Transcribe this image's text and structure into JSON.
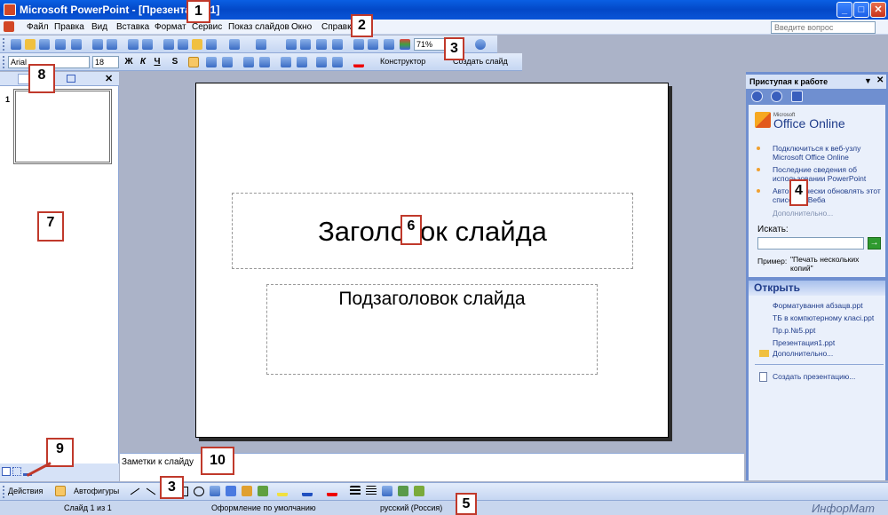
{
  "window": {
    "title": "Microsoft PowerPoint - [Презентация1]"
  },
  "menu": [
    "Файл",
    "Правка",
    "Вид",
    "Вставка",
    "Формат",
    "Сервис",
    "Показ слайдов",
    "Окно",
    "Справка"
  ],
  "help_placeholder": "Введите вопрос",
  "toolbar": {
    "zoom": "71%",
    "font": "Arial",
    "size": "18",
    "design_label": "Конструктор",
    "newslide_label": "Создать слайд",
    "bold": "Ж",
    "italic": "К",
    "underline": "Ч",
    "shadow": "S"
  },
  "left_pane": {
    "slide_number": "1"
  },
  "slide": {
    "title": "Заголовок слайда",
    "subtitle": "Подзаголовок слайда"
  },
  "notes": {
    "placeholder": "Заметки к слайду"
  },
  "task_pane": {
    "title": "Приступая к работе",
    "logo_small": "Microsoft",
    "logo_text": "Office Online",
    "links": [
      "Подключиться к веб-узлу Microsoft Office Online",
      "Последние сведения об использовании PowerPoint",
      "Автоматически обновлять этот список из Веба"
    ],
    "more": "Дополнительно...",
    "search_label": "Искать:",
    "example_label": "Пример:",
    "example_text": "\"Печать нескольких копий\"",
    "open_header": "Открыть",
    "files": [
      "Форматування абзацв.ppt",
      "ТБ в компютерному класі.ppt",
      "Пр.р.№5.ppt",
      "Презентация1.ppt"
    ],
    "open_more": "Дополнительно...",
    "create": "Создать презентацию..."
  },
  "drawing": {
    "actions": "Действия",
    "autoshapes": "Автофигуры"
  },
  "status": {
    "slide": "Слайд 1 из 1",
    "design": "Оформление по умолчанию",
    "language": "русский (Россия)"
  },
  "watermark": "ИнфорМат",
  "callouts": [
    "1",
    "2",
    "3",
    "4",
    "5",
    "6",
    "7",
    "8",
    "9",
    "10",
    "3"
  ]
}
